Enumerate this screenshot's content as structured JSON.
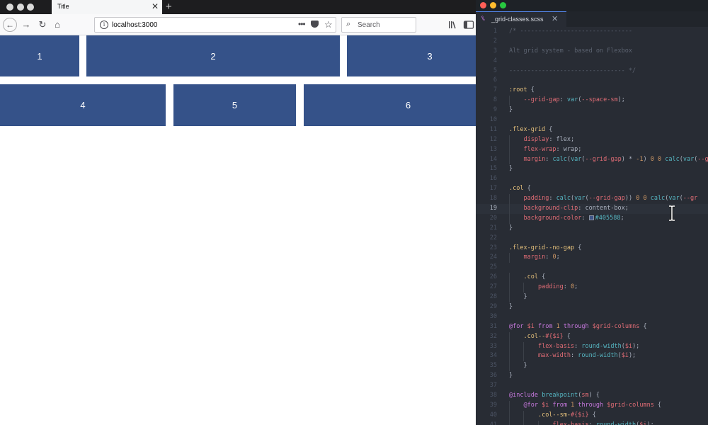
{
  "browser": {
    "tab_title": "Title",
    "tab_close": "✕",
    "new_tab": "+",
    "url": "localhost:3000",
    "url_more": "•••",
    "search_placeholder": "Search",
    "icons": [
      "back-icon",
      "forward-icon",
      "reload-icon",
      "home-icon",
      "site-info-icon",
      "page-actions-icon",
      "pocket-icon",
      "bookmark-star-icon",
      "search-icon",
      "library-icon",
      "sidebar-icon"
    ],
    "grid_cells": [
      "1",
      "2",
      "3",
      "4",
      "5",
      "6"
    ],
    "grid_color": "#355289"
  },
  "editor": {
    "tab_filename": "_grid-classes.scss",
    "tab_close": "✕",
    "active_line": 19,
    "colors": {
      "background": "#282c34",
      "keyword": "#c678dd",
      "comment": "#5c6370",
      "selector": "#e5c07b",
      "property": "#e06c75",
      "function": "#56b6c2",
      "number": "#d19a66"
    },
    "lines": [
      {
        "n": "1",
        "text": "/* -------------------------------"
      },
      {
        "n": "2",
        "text": ""
      },
      {
        "n": "3",
        "text": "Alt grid system - based on Flexbox"
      },
      {
        "n": "4",
        "text": ""
      },
      {
        "n": "5",
        "text": "-------------------------------- */"
      },
      {
        "n": "6",
        "text": ""
      },
      {
        "n": "7",
        "text": ":root {"
      },
      {
        "n": "8",
        "text": "    --grid-gap: var(--space-sm);"
      },
      {
        "n": "9",
        "text": "}"
      },
      {
        "n": "10",
        "text": ""
      },
      {
        "n": "11",
        "text": ".flex-grid {"
      },
      {
        "n": "12",
        "text": "    display: flex;"
      },
      {
        "n": "13",
        "text": "    flex-wrap: wrap;"
      },
      {
        "n": "14",
        "text": "    margin: calc(var(--grid-gap) * -1) 0 0 calc(var(--gr"
      },
      {
        "n": "15",
        "text": "}"
      },
      {
        "n": "16",
        "text": ""
      },
      {
        "n": "17",
        "text": ".col {"
      },
      {
        "n": "18",
        "text": "    padding: calc(var(--grid-gap)) 0 0 calc(var(--gr"
      },
      {
        "n": "19",
        "text": "    background-clip: content-box;"
      },
      {
        "n": "20",
        "text": "    background-color: #405588;"
      },
      {
        "n": "21",
        "text": "}"
      },
      {
        "n": "22",
        "text": ""
      },
      {
        "n": "23",
        "text": ".flex-grid--no-gap {"
      },
      {
        "n": "24",
        "text": "    margin: 0;"
      },
      {
        "n": "25",
        "text": ""
      },
      {
        "n": "26",
        "text": "    .col {"
      },
      {
        "n": "27",
        "text": "        padding: 0;"
      },
      {
        "n": "28",
        "text": "    }"
      },
      {
        "n": "29",
        "text": "}"
      },
      {
        "n": "30",
        "text": ""
      },
      {
        "n": "31",
        "text": "@for $i from 1 through $grid-columns {"
      },
      {
        "n": "32",
        "text": "    .col--#{$i} {"
      },
      {
        "n": "33",
        "text": "        flex-basis: round-width($i);"
      },
      {
        "n": "34",
        "text": "        max-width: round-width($i);"
      },
      {
        "n": "35",
        "text": "    }"
      },
      {
        "n": "36",
        "text": "}"
      },
      {
        "n": "37",
        "text": ""
      },
      {
        "n": "38",
        "text": "@include breakpoint(sm) {"
      },
      {
        "n": "39",
        "text": "    @for $i from 1 through $grid-columns {"
      },
      {
        "n": "40",
        "text": "        .col--sm-#{$i} {"
      },
      {
        "n": "41",
        "text": "            flex-basis: round-width($i);"
      }
    ]
  }
}
